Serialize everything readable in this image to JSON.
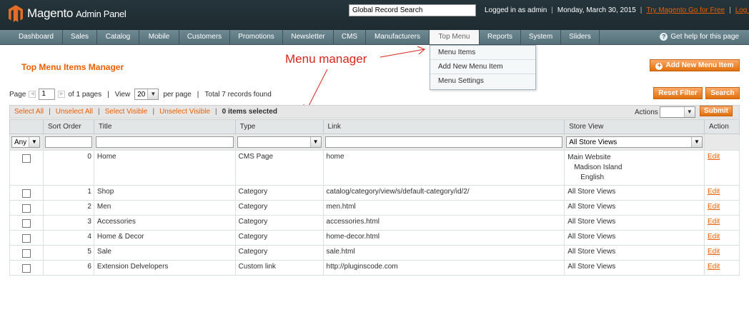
{
  "header": {
    "logo_main": "Magento",
    "logo_sub": "Admin Panel",
    "search_placeholder": "Global Record Search",
    "logged_in": "Logged in as admin",
    "date": "Monday, March 30, 2015",
    "go_link": "Try Magento Go for Free",
    "logout": "Log Out"
  },
  "nav": {
    "items": [
      "Dashboard",
      "Sales",
      "Catalog",
      "Mobile",
      "Customers",
      "Promotions",
      "Newsletter",
      "CMS",
      "Manufacturers",
      "Top Menu",
      "Reports",
      "System",
      "Sliders"
    ],
    "help": "Get help for this page"
  },
  "dropdown": {
    "items": [
      "Menu Items",
      "Add New Menu Item",
      "Menu Settings"
    ]
  },
  "page": {
    "title": "Top Menu Items Manager",
    "annotation": "Menu manager",
    "add_button": "Add New Menu Item",
    "reset_button": "Reset Filter",
    "search_button": "Search"
  },
  "pager": {
    "page_label": "Page",
    "page_value": "1",
    "of_pages": "of 1 pages",
    "view_label": "View",
    "view_value": "20",
    "per_page": "per page",
    "total": "Total 7 records found"
  },
  "massaction": {
    "select_all": "Select All",
    "unselect_all": "Unselect All",
    "select_visible": "Select Visible",
    "unselect_visible": "Unselect Visible",
    "items_selected": "0 items selected",
    "actions_label": "Actions",
    "submit": "Submit"
  },
  "grid": {
    "headers": {
      "sort": "Sort Order",
      "title": "Title",
      "type": "Type",
      "link": "Link",
      "store": "Store View",
      "action": "Action"
    },
    "filter": {
      "any": "Any",
      "store_all": "All Store Views"
    },
    "rows": [
      {
        "sort": "0",
        "title": "Home",
        "type": "CMS Page",
        "link": "home",
        "store1": "Main Website",
        "store2": "Madison Island",
        "store3": "English",
        "action": "Edit"
      },
      {
        "sort": "1",
        "title": "Shop",
        "type": "Category",
        "link": "catalog/category/view/s/default-category/id/2/",
        "store1": "All Store Views",
        "action": "Edit"
      },
      {
        "sort": "2",
        "title": "Men",
        "type": "Category",
        "link": "men.html",
        "store1": "All Store Views",
        "action": "Edit"
      },
      {
        "sort": "3",
        "title": "Accessories",
        "type": "Category",
        "link": "accessories.html",
        "store1": "All Store Views",
        "action": "Edit"
      },
      {
        "sort": "4",
        "title": "Home & Decor",
        "type": "Category",
        "link": "home-decor.html",
        "store1": "All Store Views",
        "action": "Edit"
      },
      {
        "sort": "5",
        "title": "Sale",
        "type": "Category",
        "link": "sale.html",
        "store1": "All Store Views",
        "action": "Edit"
      },
      {
        "sort": "6",
        "title": "Extension Delvelopers",
        "type": "Custom link",
        "link": "http://pluginscode.com",
        "store1": "All Store Views",
        "action": "Edit"
      }
    ]
  },
  "colors": {
    "accent": "#eb5e00",
    "header_bg": "#24353b",
    "nav_bg": "#5f7a84",
    "annotation": "#d9261c"
  }
}
